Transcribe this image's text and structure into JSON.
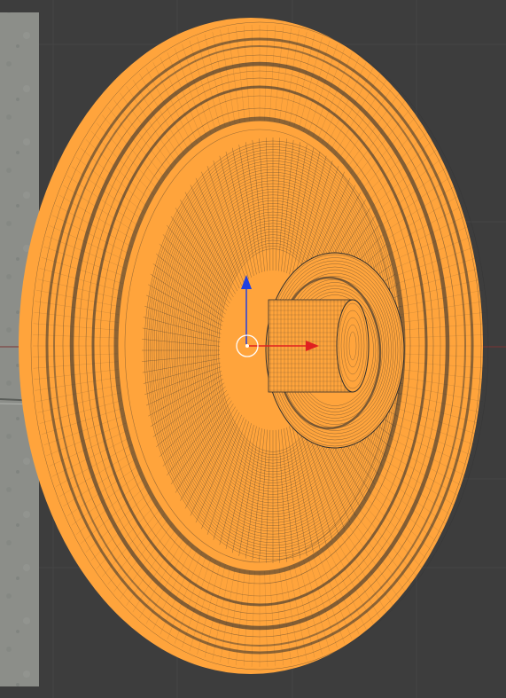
{
  "viewport": {
    "mode": "wireframe",
    "background_color": "#3d3d3d",
    "grid_line_color": "#454545",
    "axis_x_line_color": "#7a3434"
  },
  "reference_image": {
    "type": "concrete-wall-photo"
  },
  "selected_mesh": {
    "type": "wheel",
    "selected": true,
    "wire_color": "#ffa43c",
    "wire_dark_color": "#2e2e2e"
  },
  "gizmo": {
    "type": "translate",
    "x_axis_color": "#e02020",
    "z_axis_color": "#2040e0",
    "origin_color": "#ffffff",
    "origin_marker_icon": "object-origin-circle-icon"
  }
}
